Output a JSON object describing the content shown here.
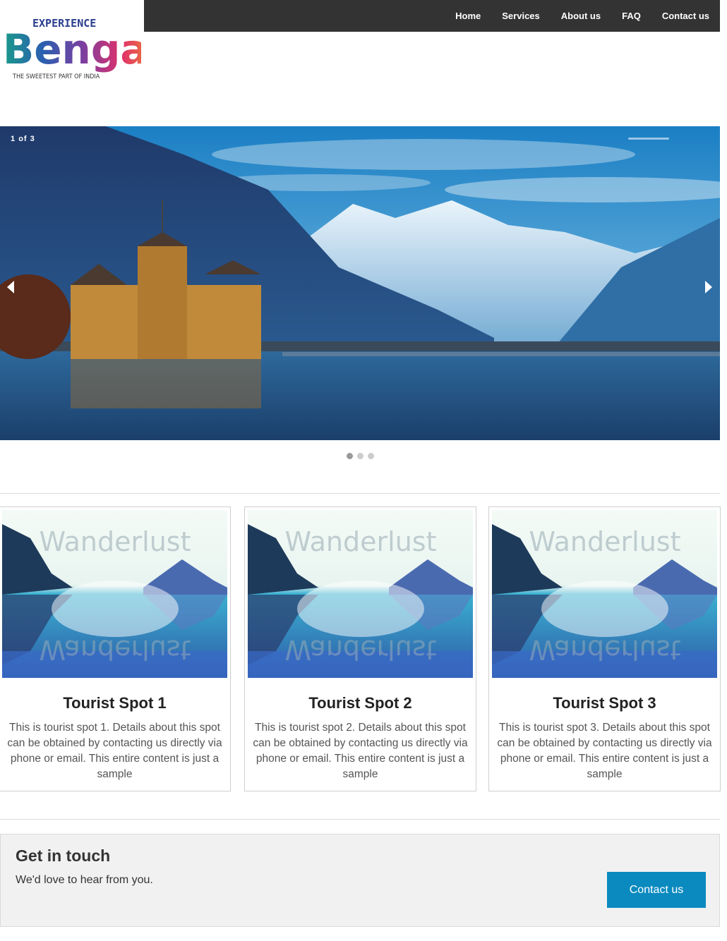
{
  "logo": {
    "top_text": "EXPERIENCE",
    "main_text": "Bengal",
    "tagline": "THE SWEETEST PART OF INDIA"
  },
  "nav": {
    "items": [
      {
        "label": "Home"
      },
      {
        "label": "Services"
      },
      {
        "label": "About us"
      },
      {
        "label": "FAQ"
      },
      {
        "label": "Contact us"
      }
    ]
  },
  "slider": {
    "current": "1",
    "of_label": "of",
    "total": "3",
    "progress": 0.33,
    "dots": [
      true,
      false,
      false
    ]
  },
  "cards": [
    {
      "image_text": "Wanderlust",
      "title": "Tourist Spot 1",
      "text": "This is tourist spot 1. Details about this spot can be obtained by contacting us directly via phone or email. This entire content is just a sample"
    },
    {
      "image_text": "Wanderlust",
      "title": "Tourist Spot 2",
      "text": "This is tourist spot 2. Details about this spot can be obtained by contacting us directly via phone or email. This entire content is just a sample"
    },
    {
      "image_text": "Wanderlust",
      "title": "Tourist Spot 3",
      "text": "This is tourist spot 3. Details about this spot can be obtained by contacting us directly via phone or email. This entire content is just a sample"
    }
  ],
  "contact": {
    "title": "Get in touch",
    "subtitle": "We'd love to hear from you.",
    "button": "Contact us"
  },
  "colors": {
    "navbar": "#333333",
    "button": "#0a8abf"
  }
}
